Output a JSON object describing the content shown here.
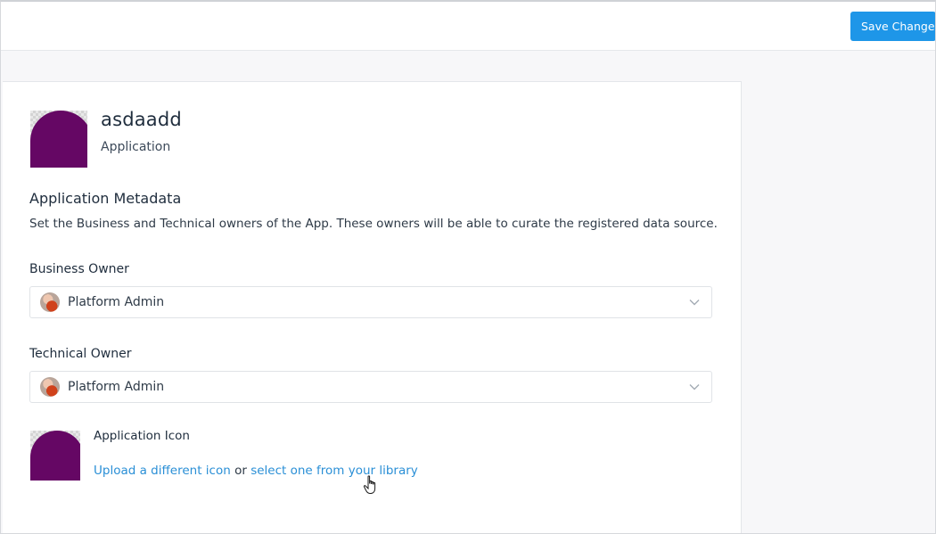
{
  "toolbar": {
    "save_label": "Save Changes"
  },
  "app": {
    "name": "asdaadd",
    "type": "Application"
  },
  "metadata": {
    "title": "Application Metadata",
    "description": "Set the Business and Technical owners of the App. These owners will be able to curate the registered data source."
  },
  "business_owner": {
    "label": "Business Owner",
    "value": "Platform Admin"
  },
  "technical_owner": {
    "label": "Technical Owner",
    "value": "Platform Admin"
  },
  "app_icon": {
    "label": "Application Icon",
    "upload_link": "Upload a different icon",
    "or_text": "or",
    "library_link": "select one from your library"
  },
  "colors": {
    "accent": "#1e96e8",
    "icon_purple": "#650764",
    "link": "#2a8fd6"
  },
  "icons": [
    "chevron-down-icon",
    "user-avatar-icon",
    "hand-pointer-cursor-icon"
  ]
}
